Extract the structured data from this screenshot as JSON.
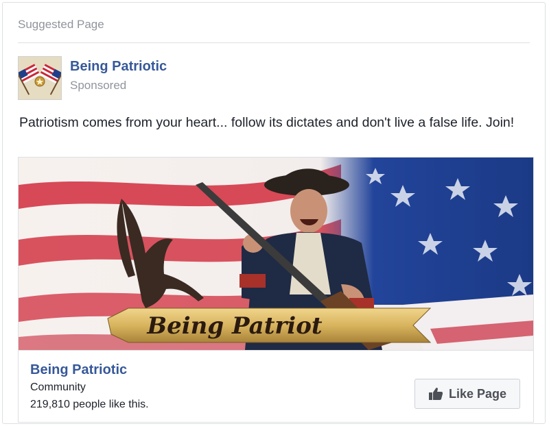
{
  "header": {
    "label": "Suggested Page"
  },
  "post": {
    "page_name": "Being Patriotic",
    "sponsored_label": "Sponsored",
    "text": "Patriotism comes from your heart... follow its dictates and don't live a false life. Join!"
  },
  "media": {
    "banner_text": "Being Patriot",
    "colors": {
      "flag_red": "#c8283a",
      "flag_blue": "#1f3f8a",
      "banner_gold": "#d8b45e"
    }
  },
  "footer": {
    "title": "Being Patriotic",
    "category": "Community",
    "likes_text": "219,810 people like this.",
    "like_button_label": "Like Page",
    "like_icon": "thumbs-up-icon"
  }
}
